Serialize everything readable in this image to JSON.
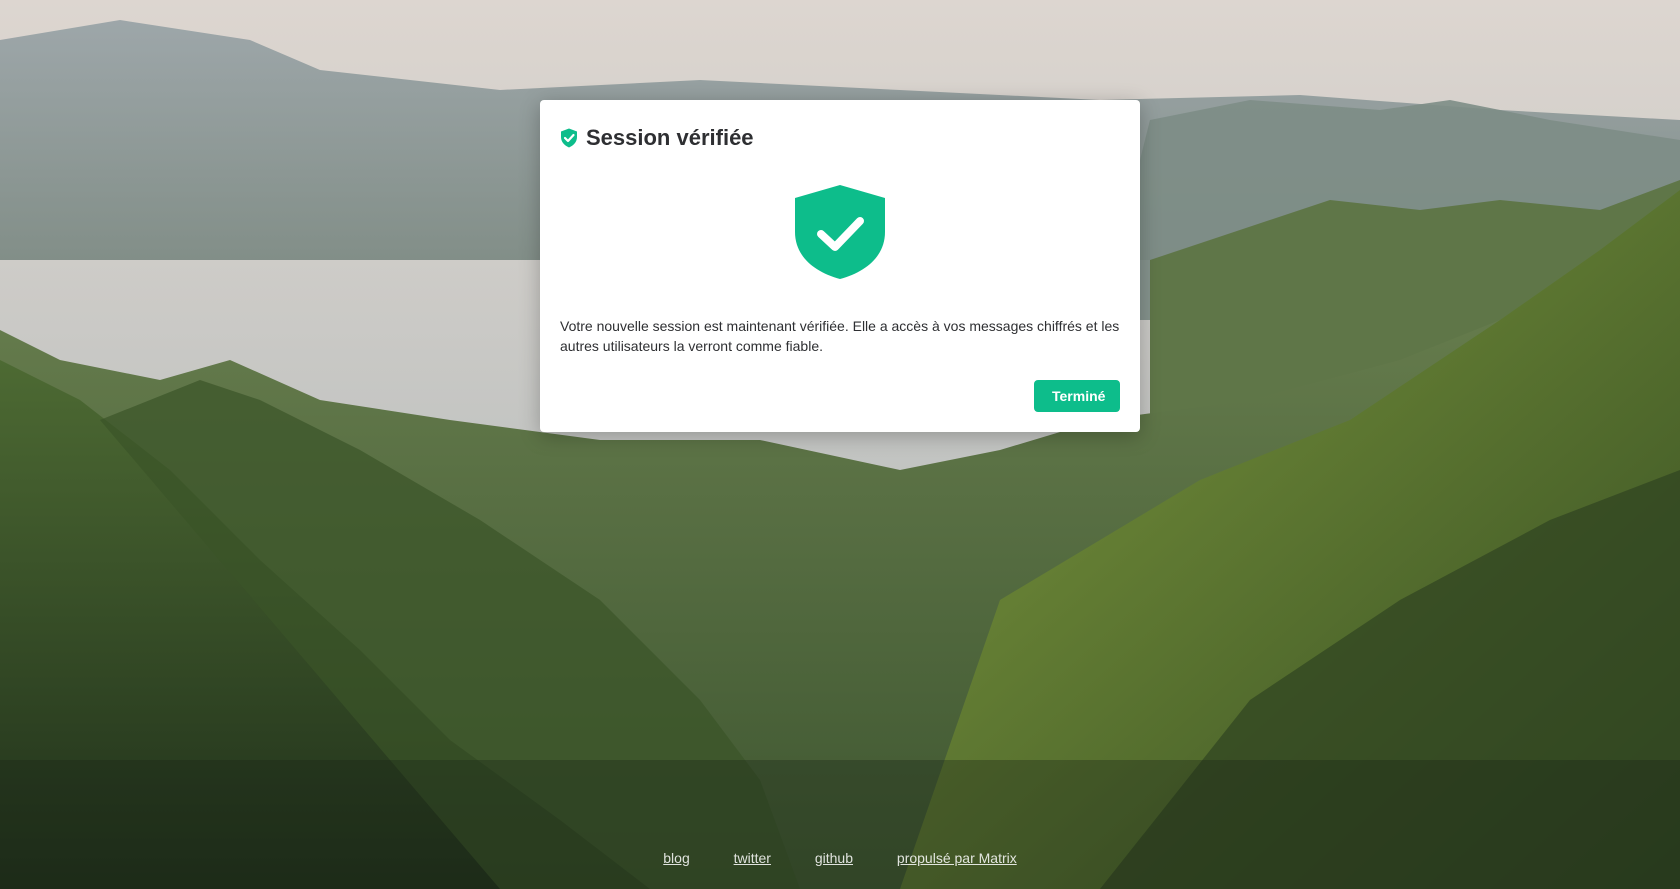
{
  "dialog": {
    "title": "Session vérifiée",
    "message": "Votre nouvelle session est maintenant vérifiée. Elle a accès à vos messages chiffrés et les autres utilisateurs la verront comme fiable.",
    "done_label": "Terminé",
    "header_icon": "verified-shield-icon",
    "main_icon": "shield-check-icon",
    "accent_color": "#0dbd8b"
  },
  "footer": {
    "links": [
      "blog",
      "twitter",
      "github",
      "propulsé par Matrix"
    ]
  }
}
